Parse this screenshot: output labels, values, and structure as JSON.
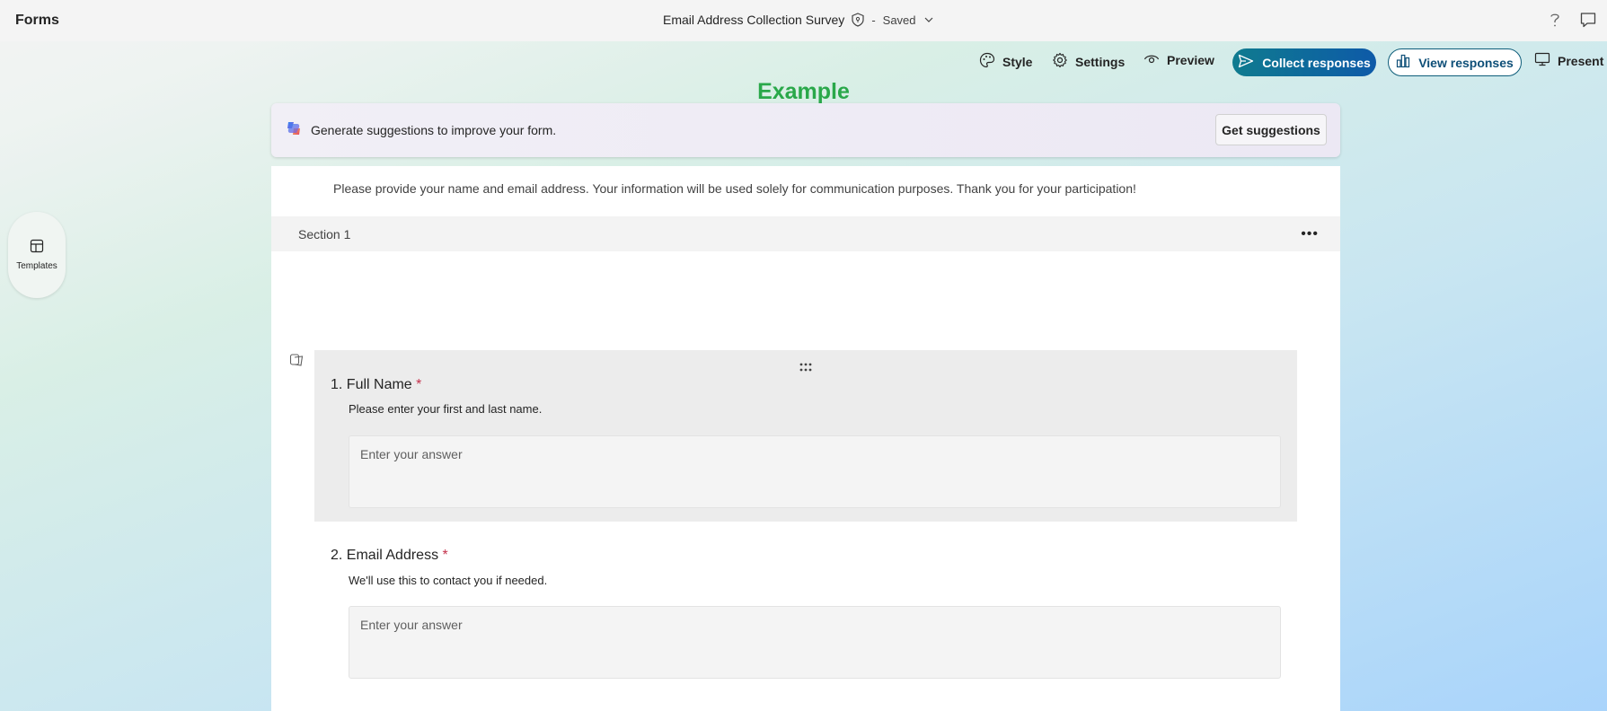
{
  "app": {
    "name": "Forms"
  },
  "header": {
    "form_title": "Email Address Collection Survey",
    "status_sep": "-",
    "status": "Saved"
  },
  "toolbar": {
    "style": "Style",
    "settings": "Settings",
    "preview": "Preview",
    "collect": "Collect responses",
    "view": "View responses",
    "present": "Present"
  },
  "banner_label": "Example",
  "suggestions": {
    "text": "Generate suggestions to improve your form.",
    "button": "Get suggestions"
  },
  "form": {
    "description": "Please provide your name and email address. Your information will be used solely for communication purposes. Thank you for your participation!",
    "section_label": "Section 1",
    "questions": [
      {
        "number": "1.",
        "title": "Full Name",
        "required_mark": "*",
        "subtitle": "Please enter your first and last name.",
        "placeholder": "Enter your answer"
      },
      {
        "number": "2.",
        "title": "Email Address",
        "required_mark": "*",
        "subtitle": "We'll use this to contact you if needed.",
        "placeholder": "Enter your answer"
      }
    ]
  },
  "sidebar": {
    "templates_label": "Templates"
  },
  "colors": {
    "accent_green": "#2aa84a",
    "collect_gradient_start": "#0f7b8f",
    "collect_gradient_end": "#0e5aa8",
    "required": "#c4314b"
  },
  "icons": [
    "shield-icon",
    "chevron-down-icon",
    "help-icon",
    "feedback-icon",
    "palette-icon",
    "gear-icon",
    "eye-icon",
    "send-icon",
    "chart-icon",
    "monitor-icon",
    "copilot-icon",
    "more-icon",
    "drag-icon",
    "templates-icon"
  ]
}
